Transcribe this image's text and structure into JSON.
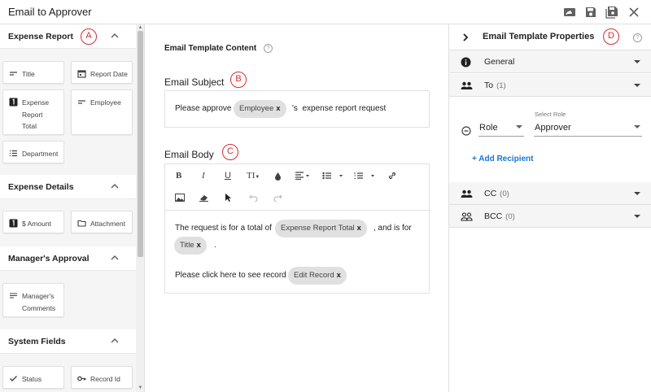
{
  "window": {
    "title": "Email to Approver"
  },
  "palette": {
    "sections": [
      {
        "title": "Expense Report",
        "fields": [
          {
            "label": "Title",
            "icon": "short-text-icon"
          },
          {
            "label": "Report Date",
            "icon": "calendar-icon"
          },
          {
            "label": "Expense Report Total",
            "icon": "number-icon"
          },
          {
            "label": "Employee",
            "icon": "short-text-icon"
          },
          {
            "label": "Department",
            "icon": "list-icon"
          }
        ]
      },
      {
        "title": "Expense Details",
        "fields": [
          {
            "label": "$ Amount",
            "icon": "number-icon"
          },
          {
            "label": "Attachment",
            "icon": "folder-icon"
          }
        ]
      },
      {
        "title": "Manager's Approval",
        "fields": [
          {
            "label": "Manager's Comments",
            "icon": "multiline-text-icon"
          }
        ]
      },
      {
        "title": "System Fields",
        "fields": [
          {
            "label": "Status",
            "icon": "check-icon"
          },
          {
            "label": "Record Id",
            "icon": "key-icon"
          }
        ]
      }
    ]
  },
  "content": {
    "heading": "Email Template Content",
    "subject": {
      "label": "Email Subject",
      "badge": "B",
      "prefix": "Please approve",
      "chip": "Employee",
      "suffix": "'s  expense report request"
    },
    "body": {
      "label": "Email Body",
      "badge": "C",
      "line1_prefix": "The request is for a total of",
      "chip_total": "Expense Report Total",
      "line1_suffix": ", and is for",
      "chip_title": "Title",
      "line2_suffix": ".",
      "line3_prefix": "Please click here to see record",
      "chip_edit": "Edit Record"
    },
    "chip_remove": "x",
    "toolbar": {
      "bold": "B",
      "italic": "I",
      "underline": "U",
      "font_size": "TI"
    }
  },
  "badges": {
    "a": "A",
    "d": "D"
  },
  "properties": {
    "title": "Email Template Properties",
    "general_label": "General",
    "to_label": "To",
    "to_count": "(1)",
    "role_label": "Role",
    "select_role_label": "Select Role",
    "select_role_value": "Approver",
    "add_recipient": "+ Add Recipient",
    "cc_label": "CC",
    "cc_count": "(0)",
    "bcc_label": "BCC",
    "bcc_count": "(0)"
  },
  "colors": {
    "accent": "#1976d2",
    "badge_red": "#d32f2f",
    "chip_bg": "#e0e0e0"
  }
}
